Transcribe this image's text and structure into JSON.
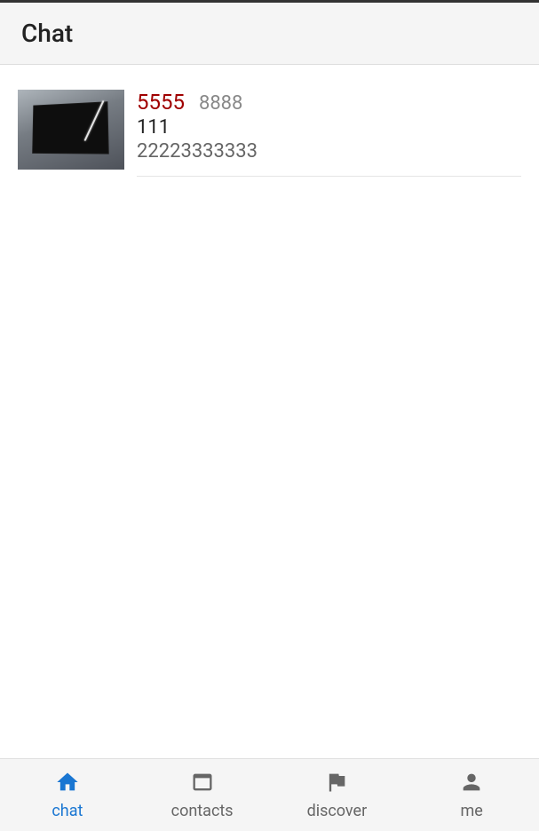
{
  "header": {
    "title": "Chat"
  },
  "chats": [
    {
      "number1": "5555",
      "number2": "8888",
      "line2": "111",
      "line3": "22223333333"
    }
  ],
  "nav": {
    "chat": "chat",
    "contacts": "contacts",
    "discover": "discover",
    "me": "me"
  }
}
